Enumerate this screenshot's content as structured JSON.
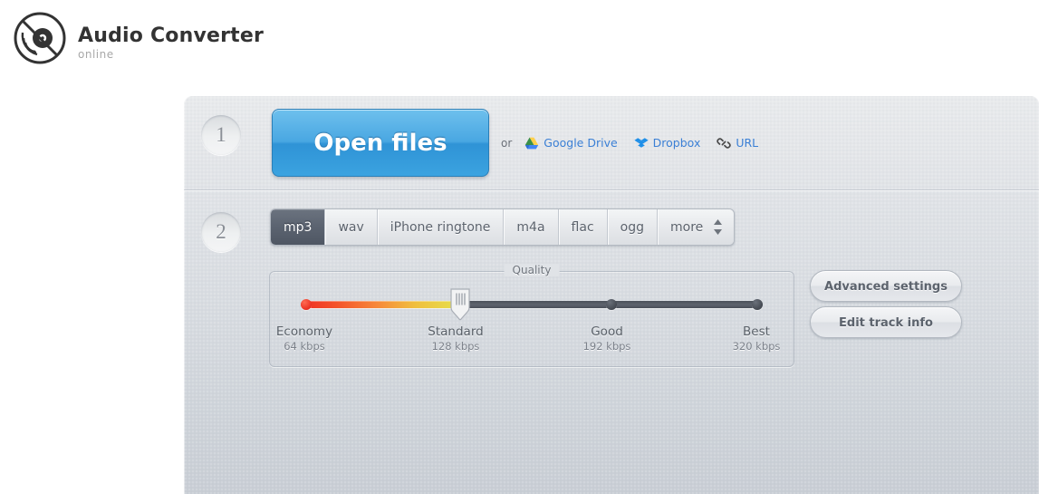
{
  "brand": {
    "title": "Audio Converter",
    "subtitle": "online",
    "logo_icon": "vinyl-record-icon"
  },
  "steps": {
    "step1_number": "1",
    "step2_number": "2"
  },
  "upload": {
    "open_files_label": "Open files",
    "or_label": "or",
    "sources": [
      {
        "label": "Google Drive",
        "icon": "google-drive-icon"
      },
      {
        "label": "Dropbox",
        "icon": "dropbox-icon"
      },
      {
        "label": "URL",
        "icon": "link-icon"
      }
    ]
  },
  "formats": {
    "selected": "mp3",
    "tabs": [
      {
        "label": "mp3",
        "active": true
      },
      {
        "label": "wav",
        "active": false
      },
      {
        "label": "iPhone ringtone",
        "active": false
      },
      {
        "label": "m4a",
        "active": false
      },
      {
        "label": "flac",
        "active": false
      },
      {
        "label": "ogg",
        "active": false
      },
      {
        "label": "more",
        "active": false
      }
    ],
    "stepper_icon": "up-down-arrows-icon"
  },
  "quality": {
    "legend": "Quality",
    "selected_index": 1,
    "selected_label": "Standard",
    "selected_bitrate": "128 kbps",
    "stops": [
      {
        "name": "Economy",
        "rate": "64 kbps"
      },
      {
        "name": "Standard",
        "rate": "128 kbps"
      },
      {
        "name": "Good",
        "rate": "192 kbps"
      },
      {
        "name": "Best",
        "rate": "320 kbps"
      }
    ]
  },
  "side_actions": {
    "advanced_settings": "Advanced settings",
    "edit_track_info": "Edit track info"
  },
  "colors": {
    "accent_blue": "#3ba3e0",
    "link_blue": "#3a7fd5",
    "active_tab": "#5b6370",
    "panel_bg": "#dfe2e6",
    "track_dark": "#5e646e",
    "quality_hot": "#ee2d24"
  }
}
